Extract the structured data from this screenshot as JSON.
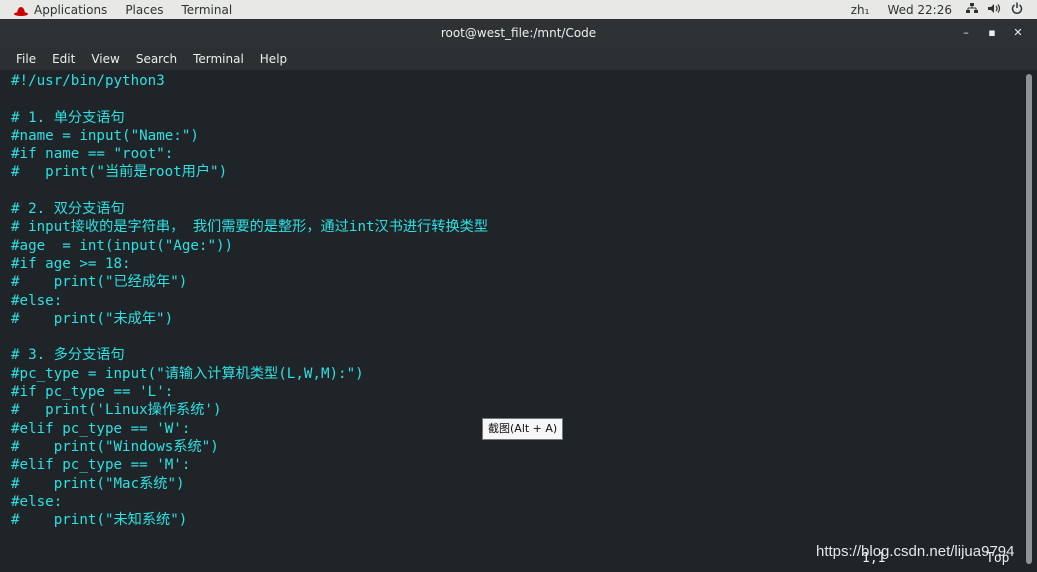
{
  "topbar": {
    "applications": "Applications",
    "places": "Places",
    "terminal": "Terminal",
    "input_method": "zh₁",
    "clock": "Wed 22:26",
    "icons": [
      "network-icon",
      "volume-icon",
      "power-icon"
    ]
  },
  "window": {
    "title": "root@west_file:/mnt/Code",
    "minimize_glyph": "–",
    "maximize_glyph": "▪",
    "close_glyph": "✕"
  },
  "menu": [
    "File",
    "Edit",
    "View",
    "Search",
    "Terminal",
    "Help"
  ],
  "code_lines": [
    "#!/usr/bin/python3",
    "",
    "# 1. 单分支语句",
    "#name = input(\"Name:\")",
    "#if name == \"root\":",
    "#   print(\"当前是root用户\")",
    "",
    "# 2. 双分支语句",
    "# input接收的是字符串， 我们需要的是整形，通过int汉书进行转换类型",
    "#age  = int(input(\"Age:\"))",
    "#if age >= 18:",
    "#    print(\"已经成年\")",
    "#else:",
    "#    print(\"未成年\")",
    "",
    "# 3. 多分支语句",
    "#pc_type = input(\"请输入计算机类型(L,W,M):\")",
    "#if pc_type == 'L':",
    "#   print('Linux操作系统')",
    "#elif pc_type == 'W':",
    "#    print(\"Windows系统\")",
    "#elif pc_type == 'M':",
    "#    print(\"Mac系统\")",
    "#else:",
    "#    print(\"未知系统\")"
  ],
  "tooltip": "截图(Alt + A)",
  "status": {
    "position": "1,1",
    "scroll": "Top"
  },
  "watermark": "https://blog.csdn.net/lijua9794",
  "colors": {
    "code_text": "#2ee0e0",
    "terminal_bg": "#1f2429",
    "titlebar_bg": "#2e3234"
  }
}
